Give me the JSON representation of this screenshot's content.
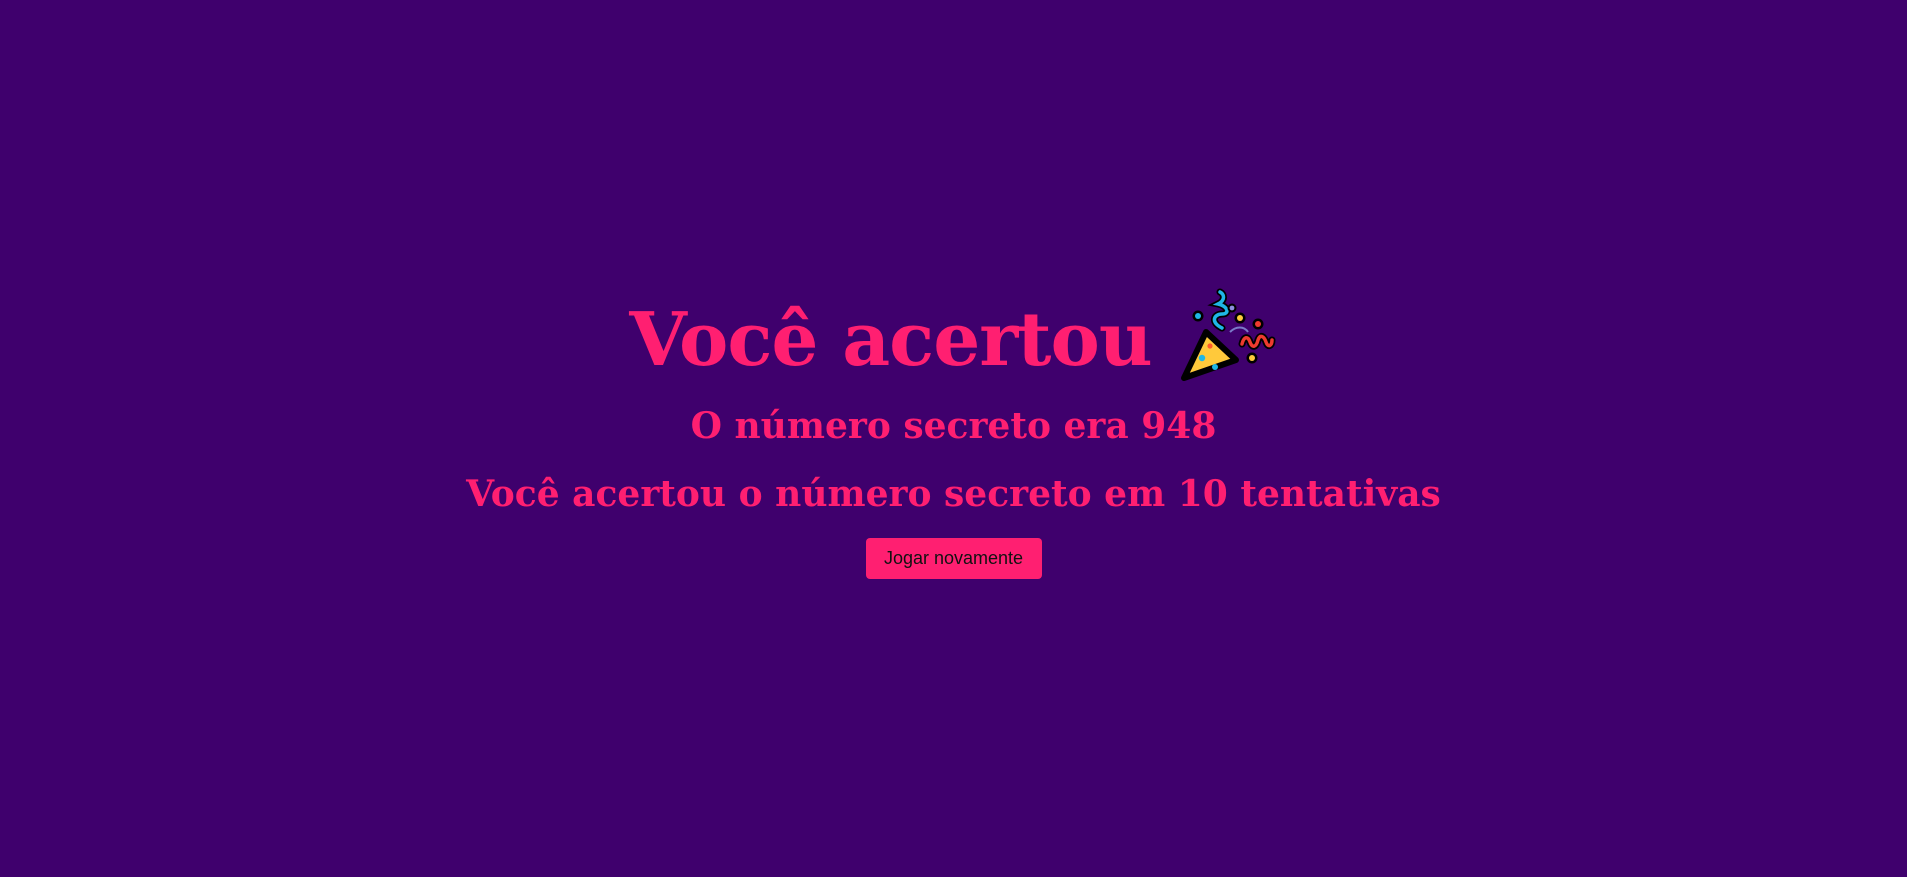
{
  "result": {
    "title": "Você acertou",
    "celebration_icon": "party-popper-icon",
    "secret_number_text": "O número secreto era 948",
    "attempts_text": "Você acertou o número secreto em 10 tentativas",
    "play_again_label": "Jogar novamente"
  },
  "colors": {
    "background": "#3f006d",
    "accent": "#ff1f71",
    "button_text": "#111111"
  }
}
